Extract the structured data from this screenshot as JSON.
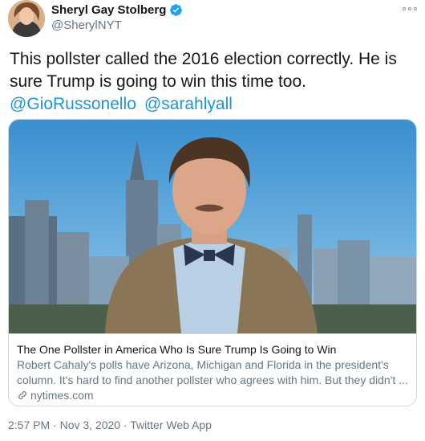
{
  "tweet": {
    "author": {
      "display_name": "Sheryl Gay Stolberg",
      "handle": "@SherylNYT",
      "verified": true
    },
    "text": "This pollster called the 2016 election correctly. He is sure Trump is going to win this time too.",
    "mentions": [
      "@GioRussonello",
      "@sarahlyall"
    ],
    "card": {
      "title": "The One Pollster in America Who Is Sure Trump Is Going to Win",
      "description": "Robert Cahaly's polls have Arizona, Michigan and Florida in the president's column. It's hard to find another pollster who agrees with him. But they didn't ...",
      "domain": "nytimes.com"
    },
    "timestamp": "2:57 PM · Nov 3, 2020",
    "source": "Twitter Web App",
    "separator": "·"
  },
  "icons": {
    "verified": "verified-badge-icon",
    "more": "more-options-icon",
    "link": "link-icon"
  },
  "colors": {
    "link": "#1b95e0",
    "secondary_text": "#657786",
    "border": "#ccd6dd"
  }
}
